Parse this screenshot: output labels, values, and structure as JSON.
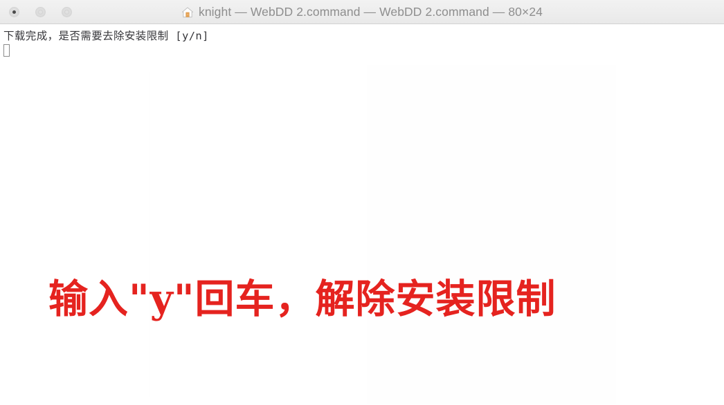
{
  "window": {
    "title": "knight — WebDD 2.command — WebDD 2.command — 80×24",
    "icon": "home-icon",
    "traffic_lights": [
      {
        "name": "close-button",
        "state": "inactive-focused"
      },
      {
        "name": "minimize-button",
        "state": "inactive"
      },
      {
        "name": "zoom-button",
        "state": "inactive"
      }
    ]
  },
  "terminal": {
    "output_line": "下载完成，是否需要去除安装限制 [y/n]",
    "cursor": "block-outline",
    "text_color": "#36363a",
    "background_color": "#ffffff"
  },
  "annotation": {
    "text": "输入\"y\"回车，解除安装限制",
    "color": "#e5231f"
  },
  "colors": {
    "titlebar_top": "#f2f2f2",
    "titlebar_bottom": "#e9e9e9",
    "titlebar_border": "#d2d2d2",
    "title_text": "#8e8e8e",
    "home_icon_accent": "#e6a355"
  }
}
